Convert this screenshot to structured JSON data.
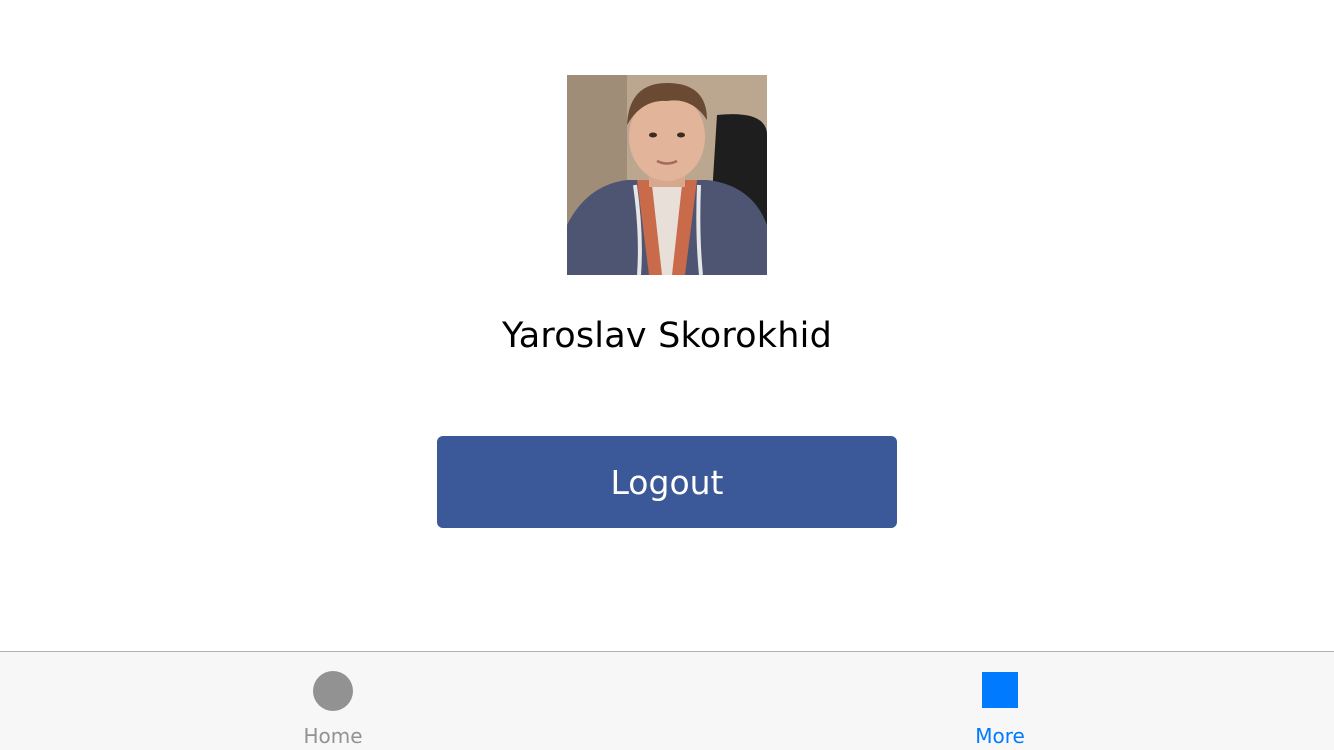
{
  "profile": {
    "name": "Yaroslav Skorokhid",
    "avatar_icon": "profile-photo"
  },
  "actions": {
    "logout_label": "Logout",
    "logout_color": "#3b5998"
  },
  "tab_bar": {
    "items": [
      {
        "label": "Home",
        "icon": "circle-icon",
        "selected": false,
        "color": "#929292"
      },
      {
        "label": "More",
        "icon": "square-icon",
        "selected": true,
        "color": "#007aff"
      }
    ]
  }
}
